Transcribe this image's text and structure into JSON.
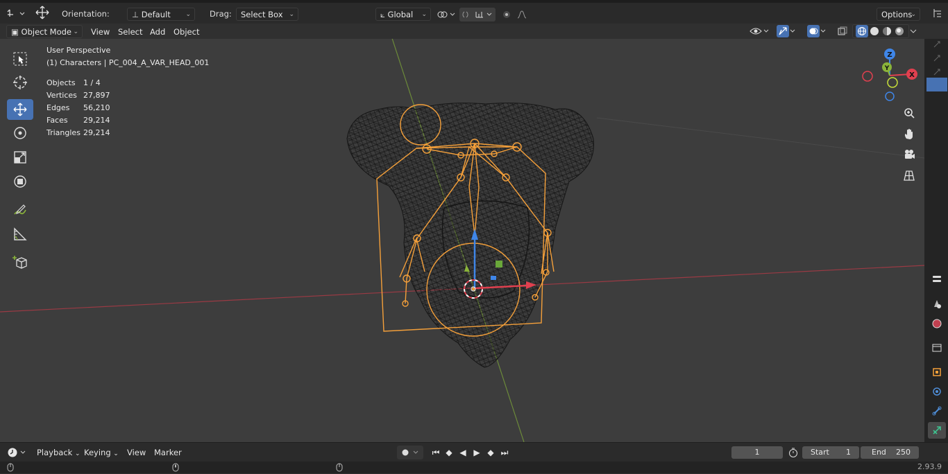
{
  "header": {
    "orientation_label": "Orientation:",
    "orientation_value": "Default",
    "drag_label": "Drag:",
    "drag_value": "Select Box",
    "transform_value": "Global",
    "options_label": "Options"
  },
  "menu": {
    "mode": "Object Mode",
    "view": "View",
    "select": "Select",
    "add": "Add",
    "object": "Object"
  },
  "overlay": {
    "perspective": "User Perspective",
    "collection": "(1) Characters | PC_004_A_VAR_HEAD_001",
    "stats": [
      {
        "label": "Objects",
        "value": "1 / 4"
      },
      {
        "label": "Vertices",
        "value": "27,897"
      },
      {
        "label": "Edges",
        "value": "56,210"
      },
      {
        "label": "Faces",
        "value": "29,214"
      },
      {
        "label": "Triangles",
        "value": "29,214"
      }
    ]
  },
  "gizmo": {
    "x": "X",
    "y": "Y",
    "z": "Z"
  },
  "timeline": {
    "playback": "Playback",
    "keying": "Keying",
    "view": "View",
    "marker": "Marker",
    "current_frame": "1",
    "start_label": "Start",
    "start_value": "1",
    "end_label": "End",
    "end_value": "250"
  },
  "status": {
    "version": "2.93.9"
  },
  "colors": {
    "accent": "#4772b3",
    "selection": "#f5a03a",
    "x_axis": "#e0404f",
    "y_axis": "#8ab43a",
    "z_axis": "#3f86e8"
  }
}
